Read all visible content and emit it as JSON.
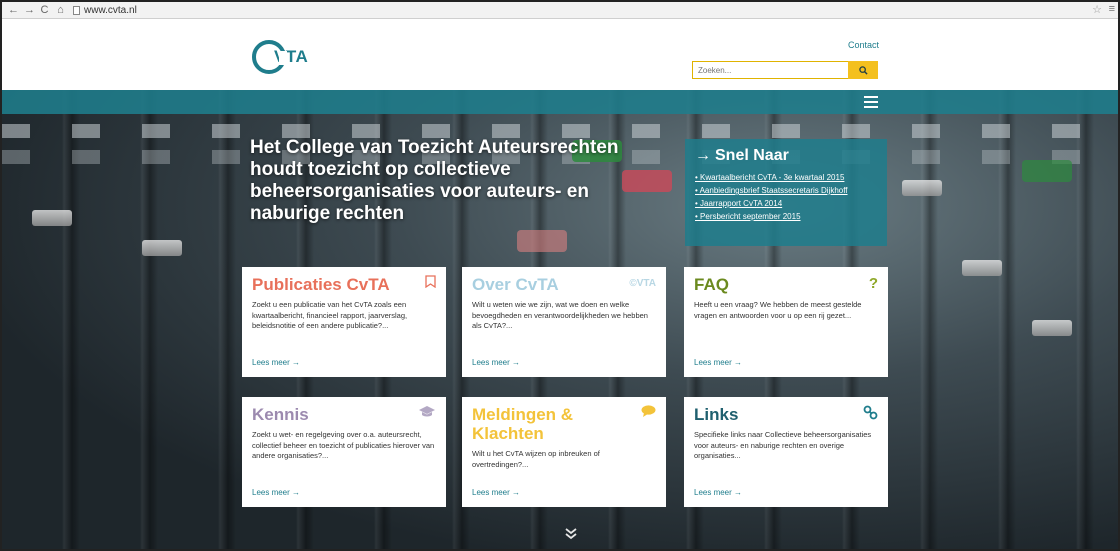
{
  "browser": {
    "nav_back": "←",
    "nav_forward": "→",
    "nav_reload": "C",
    "nav_home": "⌂",
    "url": "www.cvta.nl"
  },
  "header": {
    "logo_text": "VTA",
    "contact_label": "Contact",
    "search_placeholder": "Zoeken...",
    "search_icon": "search-icon"
  },
  "hero": {
    "title": "Het College van Toezicht Auteursrechten houdt toezicht op collectieve beheersorganisaties voor auteurs- en naburige rechten"
  },
  "snel_naar": {
    "arrow": "→",
    "title": "Snel Naar",
    "links": [
      "Kwartaalbericht CvTA - 3e kwartaal 2015",
      "Aanbiedingsbrief Staatssecretaris Dijkhoff",
      "Jaarrapport CvTA 2014",
      "Persbericht september 2015"
    ]
  },
  "cards": [
    {
      "title": "Publicaties CvTA",
      "color": "#e8705a",
      "icon": "bookmark-icon",
      "icon_glyph": "⚐",
      "text": "Zoekt u een publicatie van het CvTA zoals een kwartaalbericht, financieel rapport, jaarverslag, beleidsnotitie of een andere publicatie?...",
      "more": "Lees meer →"
    },
    {
      "title": "Over CvTA",
      "color": "#a8cfe0",
      "icon": "cvta-logo-icon",
      "icon_glyph": "©VTA",
      "text": "Wilt u weten wie we zijn, wat we doen en welke bevoegdheden en verantwoordelijkheden we hebben als CvTA?...",
      "more": "Lees meer →"
    },
    {
      "title": "FAQ",
      "color": "#6b8a1f",
      "icon": "question-icon",
      "icon_glyph": "?",
      "text": "Heeft u een vraag? We hebben de meest gestelde vragen en antwoorden voor u op een rij gezet...",
      "more": "Lees meer →"
    },
    {
      "title": "Kennis",
      "color": "#9c8aaf",
      "icon": "graduation-cap-icon",
      "icon_glyph": "🎓",
      "text": "Zoekt u wet- en regelgeving over o.a. auteursrecht, collectief beheer en toezicht of publicaties hierover van andere organisaties?...",
      "more": "Lees meer →"
    },
    {
      "title": "Meldingen & Klachten",
      "color": "#f3c33a",
      "icon": "chat-icon",
      "icon_glyph": "💬",
      "text": "Wilt u het CvTA wijzen op inbreuken of overtredingen?...",
      "more": "Lees meer →"
    },
    {
      "title": "Links",
      "color": "#1f5f6e",
      "icon": "link-icon",
      "icon_glyph": "🔗",
      "text": "Specifieke links naar Collectieve beheersorganisaties voor auteurs- en naburige rechten en overige organisaties...",
      "more": "Lees meer →"
    }
  ],
  "colors": {
    "teal": "#1f7d8c",
    "yellow": "#f4c01e"
  },
  "scroll_down_icon": "chevron-double-down-icon"
}
